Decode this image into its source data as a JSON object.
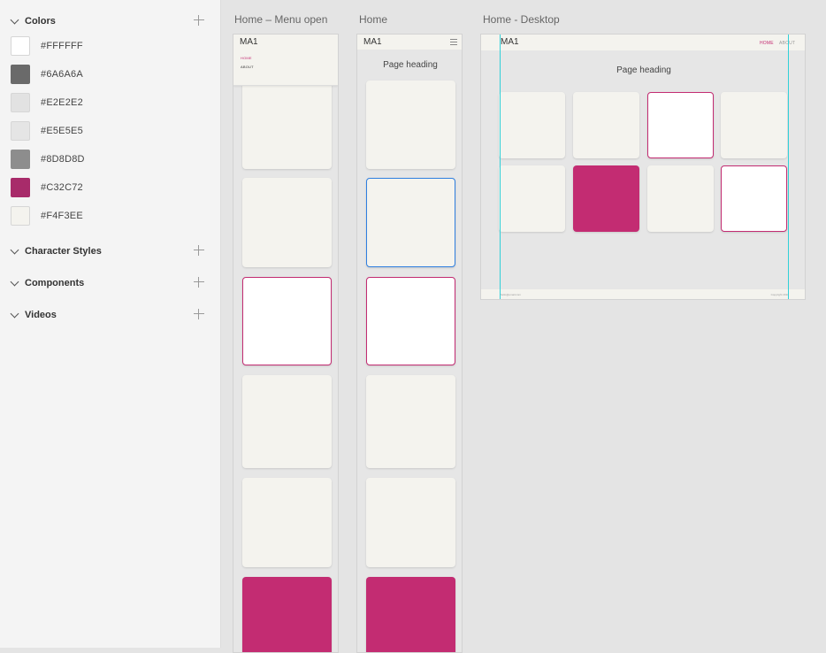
{
  "sidebar": {
    "colors": {
      "title": "Colors",
      "swatches": [
        {
          "hex": "#FFFFFF",
          "label": "#FFFFFF"
        },
        {
          "hex": "#6A6A6A",
          "label": "#6A6A6A"
        },
        {
          "hex": "#E2E2E2",
          "label": "#E2E2E2"
        },
        {
          "hex": "#E5E5E5",
          "label": "#E5E5E5"
        },
        {
          "hex": "#8D8D8D",
          "label": "#8D8D8D"
        },
        {
          "hex": "#C32C72",
          "label": "#C32C72"
        },
        {
          "hex": "#F4F3EE",
          "label": "#F4F3EE"
        }
      ]
    },
    "character_styles": {
      "title": "Character Styles"
    },
    "components": {
      "title": "Components"
    },
    "videos": {
      "title": "Videos"
    }
  },
  "artboards": {
    "menu_open": {
      "title": "Home – Menu open",
      "logo": "MA1",
      "menu": {
        "home": "HOME",
        "about": "ABOUT"
      }
    },
    "home": {
      "title": "Home",
      "logo": "MA1",
      "heading": "Page heading"
    },
    "desktop": {
      "title": "Home - Desktop",
      "logo": "MA1",
      "nav": {
        "home": "HOME",
        "about": "ABOUT"
      },
      "heading": "Page heading",
      "footer": {
        "left": "hello@email.com",
        "right": "Copyright 2018"
      }
    }
  },
  "colors": {
    "accent": "#C32C72",
    "card": "#F4F3EE",
    "selection": "#2F7FE0",
    "guide": "#30D0D8"
  }
}
